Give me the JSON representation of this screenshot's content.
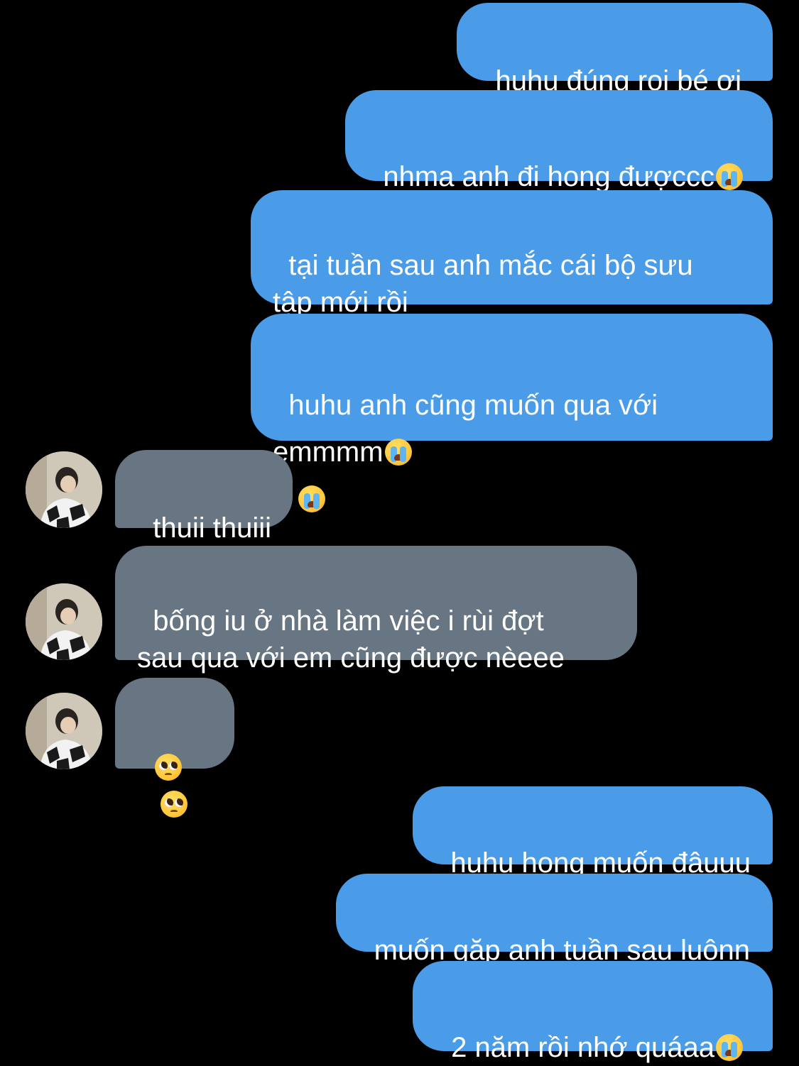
{
  "messages": [
    {
      "from": "me",
      "text": "huhu đúng roi bé ơi"
    },
    {
      "from": "me",
      "text": "nhma anh đi hong đượccc",
      "emoji": [
        "loudly-crying-face"
      ]
    },
    {
      "from": "me",
      "text": "tại tuần sau anh mắc cái bộ sưu\ntập mới rồi"
    },
    {
      "from": "me",
      "text": "huhu anh cũng muốn qua với\nemmmm",
      "emoji": [
        "loudly-crying-face",
        "loudly-crying-face"
      ]
    },
    {
      "from": "them",
      "text": "thuii thuiii"
    },
    {
      "from": "them",
      "text": "bống iu ở nhà làm việc i rùi đợt\nsau qua với em cũng được nèeee"
    },
    {
      "from": "them",
      "text": "",
      "emoji": [
        "pleading-face",
        "pleading-face"
      ]
    },
    {
      "from": "me",
      "text": "huhu hong muốn đâuuu"
    },
    {
      "from": "me",
      "text": "muốn gặp anh tuần sau luônn"
    },
    {
      "from": "me",
      "text": "2 năm rồi nhớ quáaa",
      "emoji": [
        "loudly-crying-face"
      ]
    }
  ],
  "colors": {
    "background": "#000000",
    "outgoing_bubble": "#4a9ce8",
    "incoming_bubble": "#687684",
    "text": "#ffffff"
  },
  "icons": {
    "avatar": "contact-photo",
    "cry": "loudly-crying-face",
    "plead": "pleading-face"
  }
}
